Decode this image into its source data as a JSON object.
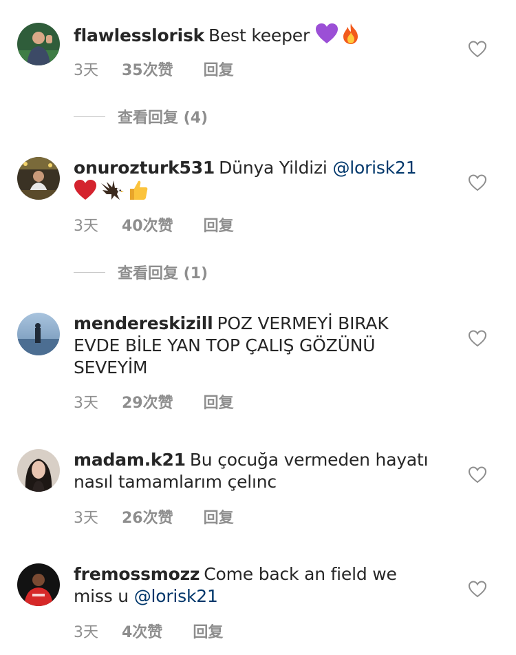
{
  "comments": [
    {
      "username": "flawlesslorisk",
      "text": "Best keeper",
      "emoji": [
        "purple-heart-icon",
        "fire-icon"
      ],
      "time": "3天",
      "likes": "35次赞",
      "reply": "回复",
      "view_replies": "查看回复 (4)"
    },
    {
      "username": "onurozturk531",
      "text": "Dünya Yildizi",
      "mention": "@lorisk21",
      "emoji": [
        "red-heart-icon",
        "eagle-icon",
        "thumbs-up-icon"
      ],
      "time": "3天",
      "likes": "40次赞",
      "reply": "回复",
      "view_replies": "查看回复 (1)"
    },
    {
      "username": "menderеskizill",
      "text_line1": "POZ VERMEYİ BIRAK",
      "text_line2": "EVDE BİLE YAN TOP ÇALIŞ GÖZÜNÜ",
      "text_line3": "SEVEYİM",
      "time": "3天",
      "likes": "29次赞",
      "reply": "回复"
    },
    {
      "username": "madam.k21",
      "text_line1": "Bu çocuğa vermeden hayatı",
      "text_line2": "nasıl tamamlarım çelınc",
      "time": "3天",
      "likes": "26次赞",
      "reply": "回复"
    },
    {
      "username": "fremossmozz",
      "text_line1": "Come back an field we",
      "text_line2": "miss u",
      "mention": "@lorisk21",
      "time": "3天",
      "likes": "4次赞",
      "reply": "回复"
    }
  ],
  "colors": {
    "text": "#262626",
    "meta": "#8e8e8e",
    "mention": "#00376b"
  }
}
